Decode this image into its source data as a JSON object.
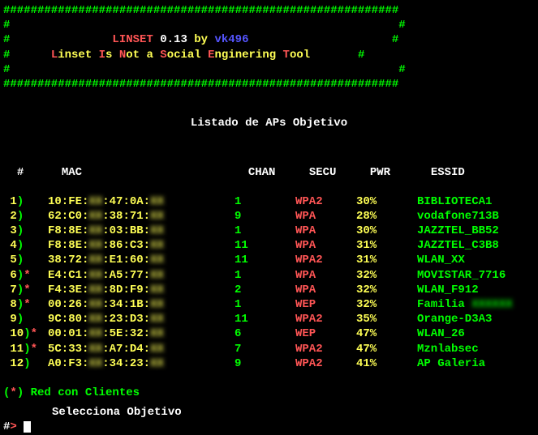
{
  "banner": {
    "hash_top": "##########################################################",
    "title_1_pre": "#               ",
    "title_1_app": "LINSET",
    "title_1_ver": " 0.13 ",
    "title_1_by": "by",
    "title_1_author": " vk496",
    "title_1_post": "                     #",
    "title_2_pre": "#      ",
    "t2_L": "L",
    "t2_inset": "inset ",
    "t2_I": "I",
    "t2_s": "s ",
    "t2_N": "N",
    "t2_ot": "ot a ",
    "t2_S": "S",
    "t2_ocial": "ocial ",
    "t2_E": "E",
    "t2_nginering": "nginering ",
    "t2_T": "T",
    "t2_ool": "ool",
    "title_2_post": "       #",
    "side_l": "#",
    "side_r": "                                                         #"
  },
  "section_title": "Listado de APs Objetivo",
  "headers": {
    "idx": "#",
    "mac": "MAC",
    "chan": "CHAN",
    "secu": "SECU",
    "pwr": "PWR",
    "essid": "ESSID"
  },
  "rows": [
    {
      "n": "1",
      "star": "",
      "mac_a": "10:FE:",
      "mac_h": "XX",
      "mac_b": ":47:0A:",
      "mac_t": "XX",
      "chan": "1",
      "secu": "WPA2",
      "pwr": "30%",
      "essid": "BIBLIOTECA1",
      "essid_blur": ""
    },
    {
      "n": "2",
      "star": "",
      "mac_a": "62:C0:",
      "mac_h": "XX",
      "mac_b": ":38:71:",
      "mac_t": "XX",
      "chan": "9",
      "secu": "WPA",
      "pwr": "28%",
      "essid": "vodafone713B",
      "essid_blur": ""
    },
    {
      "n": "3",
      "star": "",
      "mac_a": "F8:8E:",
      "mac_h": "XX",
      "mac_b": ":03:BB:",
      "mac_t": "XX",
      "chan": "1",
      "secu": "WPA",
      "pwr": "30%",
      "essid": "JAZZTEL_BB52",
      "essid_blur": ""
    },
    {
      "n": "4",
      "star": "",
      "mac_a": "F8:8E:",
      "mac_h": "XX",
      "mac_b": ":86:C3:",
      "mac_t": "XX",
      "chan": "11",
      "secu": "WPA",
      "pwr": "31%",
      "essid": "JAZZTEL_C3B8",
      "essid_blur": ""
    },
    {
      "n": "5",
      "star": "",
      "mac_a": "38:72:",
      "mac_h": "XX",
      "mac_b": ":E1:60:",
      "mac_t": "XX",
      "chan": "11",
      "secu": "WPA2",
      "pwr": "31%",
      "essid": "WLAN_XX",
      "essid_blur": ""
    },
    {
      "n": "6",
      "star": "*",
      "mac_a": "E4:C1:",
      "mac_h": "XX",
      "mac_b": ":A5:77:",
      "mac_t": "XX",
      "chan": "1",
      "secu": "WPA",
      "pwr": "32%",
      "essid": "MOVISTAR_7716",
      "essid_blur": ""
    },
    {
      "n": "7",
      "star": "*",
      "mac_a": "F4:3E:",
      "mac_h": "XX",
      "mac_b": ":8D:F9:",
      "mac_t": "XX",
      "chan": "2",
      "secu": "WPA",
      "pwr": "32%",
      "essid": "WLAN_F912",
      "essid_blur": ""
    },
    {
      "n": "8",
      "star": "*",
      "mac_a": "00:26:",
      "mac_h": "XX",
      "mac_b": ":34:1B:",
      "mac_t": "XX",
      "chan": "1",
      "secu": "WEP",
      "pwr": "32%",
      "essid": "Familia ",
      "essid_blur": "XXXXXX"
    },
    {
      "n": "9",
      "star": "",
      "mac_a": "9C:80:",
      "mac_h": "XX",
      "mac_b": ":23:D3:",
      "mac_t": "XX",
      "chan": "11",
      "secu": "WPA2",
      "pwr": "35%",
      "essid": "Orange-D3A3",
      "essid_blur": ""
    },
    {
      "n": "10",
      "star": "*",
      "mac_a": "00:01:",
      "mac_h": "XX",
      "mac_b": ":5E:32:",
      "mac_t": "XX",
      "chan": "6",
      "secu": "WEP",
      "pwr": "47%",
      "essid": "WLAN_26",
      "essid_blur": ""
    },
    {
      "n": "11",
      "star": "*",
      "mac_a": "5C:33:",
      "mac_h": "XX",
      "mac_b": ":A7:D4:",
      "mac_t": "XX",
      "chan": "7",
      "secu": "WPA2",
      "pwr": "47%",
      "essid": "Mznlabsec",
      "essid_blur": ""
    },
    {
      "n": "12",
      "star": "",
      "mac_a": "A0:F3:",
      "mac_h": "XX",
      "mac_b": ":34:23:",
      "mac_t": "XX",
      "chan": "9",
      "secu": "WPA2",
      "pwr": "41%",
      "essid": "AP Galeria",
      "essid_blur": ""
    }
  ],
  "legend_l": "(",
  "legend_star": "*",
  "legend_r": ") Red con Clientes",
  "prompt_label": "Selecciona Objetivo",
  "prompt_deco_l": "      #",
  "prompt_arrow": ">",
  "prompt_space": " "
}
